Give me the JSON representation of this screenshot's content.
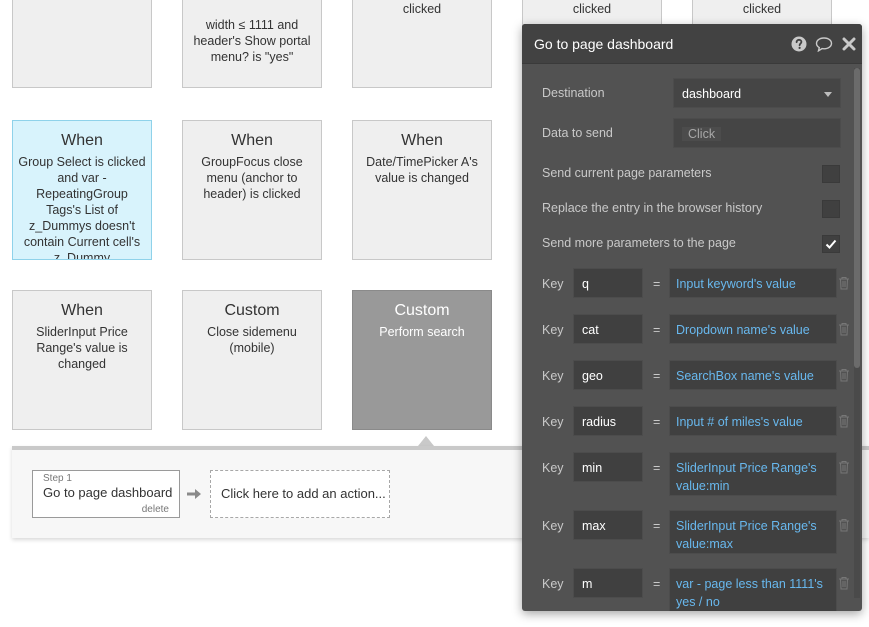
{
  "cards": {
    "r1c1": {
      "desc": ""
    },
    "r1c2": {
      "desc": "width ≤ 1111 and header's Show portal menu? is \"yes\""
    },
    "r1c3": {
      "desc": "clicked"
    },
    "r1c4": {
      "desc": "clicked"
    },
    "r1c5": {
      "desc": "clicked"
    },
    "r2c1": {
      "title": "When",
      "desc": "Group Select is clicked and var - RepeatingGroup Tags's List of z_Dummys doesn't contain Current cell's z_Dummy"
    },
    "r2c2": {
      "title": "When",
      "desc": "GroupFocus close menu (anchor to header) is clicked"
    },
    "r2c3": {
      "title": "When",
      "desc": "Date/TimePicker A's value is changed"
    },
    "r3c1": {
      "title": "When",
      "desc": "SliderInput Price Range's value is changed"
    },
    "r3c2": {
      "title": "Custom",
      "desc": "Close sidemenu (mobile)"
    },
    "r3c3": {
      "title": "Custom",
      "desc": "Perform search"
    }
  },
  "actions": {
    "step_label": "Step 1",
    "step_name": "Go to page dashboard",
    "delete_label": "delete",
    "add_action": "Click here to add an action..."
  },
  "editor": {
    "title": "Go to page dashboard",
    "destination_label": "Destination",
    "destination_value": "dashboard",
    "data_label": "Data to send",
    "data_placeholder": "Click",
    "send_params_label": "Send current page parameters",
    "send_params_checked": false,
    "replace_label": "Replace the entry in the browser history",
    "replace_checked": false,
    "more_params_label": "Send more parameters to the page",
    "more_params_checked": true,
    "key_label": "Key",
    "eq_label": "=",
    "params": [
      {
        "key": "q",
        "value": "Input keyword's value"
      },
      {
        "key": "cat",
        "value": "Dropdown name's value"
      },
      {
        "key": "geo",
        "value": "SearchBox name's value"
      },
      {
        "key": "radius",
        "value": "Input # of miles's value"
      },
      {
        "key": "min",
        "value": "SliderInput Price Range's value:min"
      },
      {
        "key": "max",
        "value": "SliderInput Price Range's value:max"
      },
      {
        "key": "m",
        "value": "var - page less than 1111's yes / no"
      }
    ]
  },
  "colors": {
    "accent_blue": "#68b8ee",
    "selected_card": "#d8f3fc",
    "editor_bg": "#525252"
  }
}
